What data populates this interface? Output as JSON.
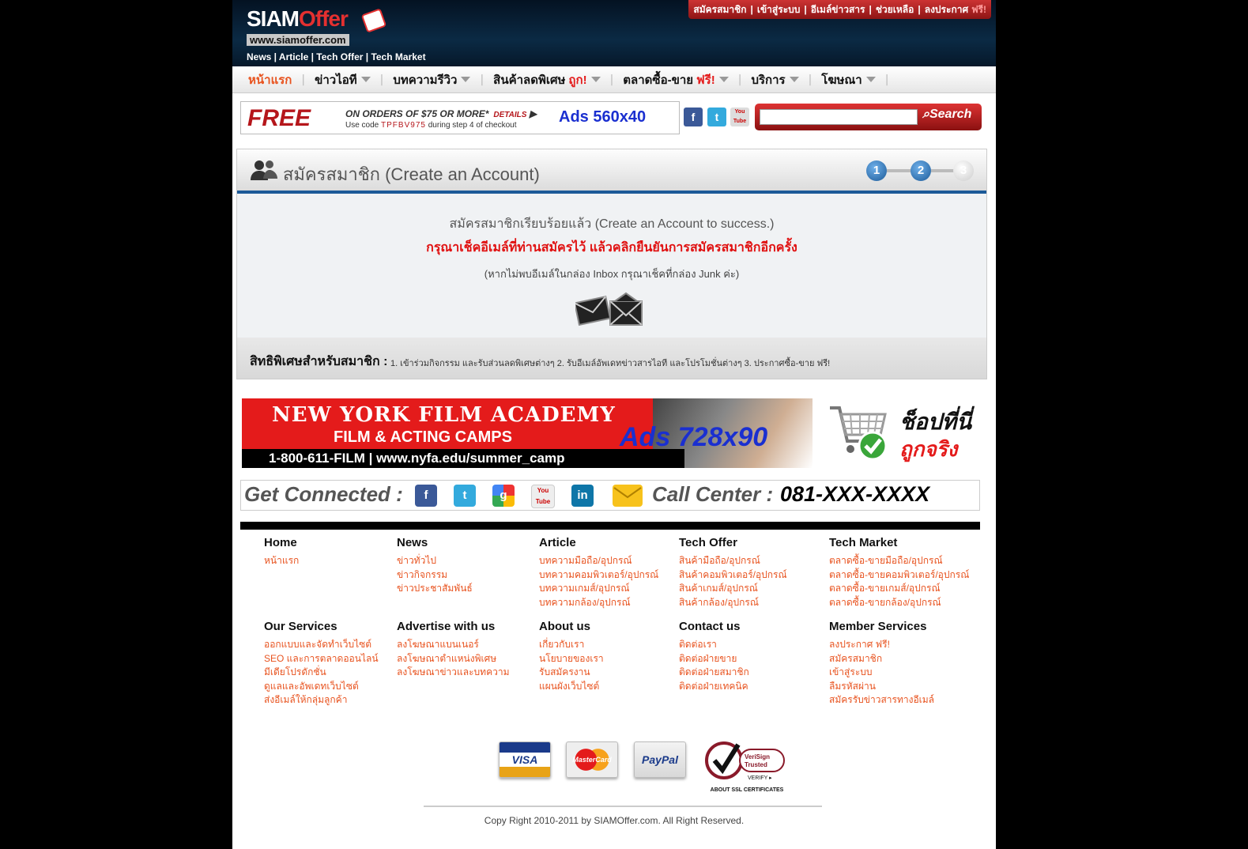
{
  "header": {
    "logo_text_a": "SIAM",
    "logo_text_b": "Offer",
    "logo_url": "www.siamoffer.com",
    "logo_sub": "News | Article | Tech Offer | Tech Market",
    "toplinks": [
      "สมัครสมาชิก",
      "เข้าสู่ระบบ",
      "อีเมล์ข่าวสาร",
      "ช่วยเหลือ",
      "ลงประกาศ"
    ],
    "toplinks_free": "ฟรี!"
  },
  "nav": {
    "items": [
      {
        "label": "หน้าแรก"
      },
      {
        "label": "ข่าวไอที"
      },
      {
        "label": "บทความรีวิว"
      },
      {
        "label": "สินค้าลดพิเศษ",
        "tag": "ถูก!"
      },
      {
        "label": "ตลาดซื้อ-ขาย",
        "tag": "ฟรี!"
      },
      {
        "label": "บริการ"
      },
      {
        "label": "โฆษณา"
      }
    ]
  },
  "ad_small": {
    "free": "FREE",
    "line1": "ON ORDERS OF $75 OR MORE*",
    "details": "DETAILS",
    "line2_a": "Use code",
    "line2_code": "TPFBV975",
    "line2_b": "during step 4 of checkout",
    "label": "Ads 560x40"
  },
  "social_top": [
    "f",
    "t",
    "You Tube"
  ],
  "search": {
    "placeholder": "",
    "button": "Search"
  },
  "account": {
    "title": "สมัครสมาชิก (Create an Account)",
    "steps": [
      "1",
      "2",
      "3"
    ],
    "msg1": "สมัครสมาชิกเรียบร้อยแล้ว (Create an Account to success.)",
    "msg2": "กรุณาเช็คอีเมล์ที่ท่านสมัครไว้ แล้วคลิกยืนยันการสมัครสมาชิกอีกครั้ง",
    "msg3": "(หากไม่พบอีเมล์ในกล่อง Inbox กรุณาเช็คที่กล่อง Junk ค่ะ)",
    "privileges_title": "สิทธิพิเศษสำหรับสมาชิก :",
    "privileges_text": "1. เข้าร่วมกิจกรรม และรับส่วนลดพิเศษต่างๆ   2. รับอีเมล์อัพเดทข่าวสารไอที และโปรโมชั่นต่างๆ   3. ประกาศซื้อ-ขาย ฟรี!"
  },
  "ad_big": {
    "line1": "NEW YORK FILM ACADEMY",
    "line2": "FILM & ACTING CAMPS",
    "line3": "1-800-611-FILM  |  www.nyfa.edu/summer_camp",
    "label": "Ads 728x90"
  },
  "cart_ad": {
    "line1": "ช็อปที่นี่",
    "line2": "ถูกจริง"
  },
  "connect": {
    "label": "Get Connected :",
    "icons": [
      "f",
      "t",
      "g",
      "You Tube",
      "in"
    ],
    "call": "Call Center :",
    "phone": "081-XXX-XXXX"
  },
  "footer": {
    "columns": [
      {
        "title": "Home",
        "links": [
          "หน้าแรก"
        ]
      },
      {
        "title": "News",
        "links": [
          "ข่าวทั่วไป",
          "ข่าวกิจกรรม",
          "ข่าวประชาสัมพันธ์"
        ]
      },
      {
        "title": "Article",
        "links": [
          "บทความมือถือ/อุปกรณ์",
          "บทความคอมพิวเตอร์/อุปกรณ์",
          "บทความเกมส์/อุปกรณ์",
          "บทความกล้อง/อุปกรณ์"
        ]
      },
      {
        "title": "Tech Offer",
        "links": [
          "สินค้ามือถือ/อุปกรณ์",
          "สินค้าคอมพิวเตอร์/อุปกรณ์",
          "สินค้าเกมส์/อุปกรณ์",
          "สินค้ากล้อง/อุปกรณ์"
        ]
      },
      {
        "title": "Tech Market",
        "links": [
          "ตลาดซื้อ-ขายมือถือ/อุปกรณ์",
          "ตลาดซื้อ-ขายคอมพิวเตอร์/อุปกรณ์",
          "ตลาดซื้อ-ขายเกมส์/อุปกรณ์",
          "ตลาดซื้อ-ขายกล้อง/อุปกรณ์"
        ]
      },
      {
        "title": "Our Services",
        "links": [
          "ออกแบบและจัดทำเว็บไซต์",
          "SEO และการตลาดออนไลน์",
          "มีเดียโปรดักชั่น",
          "ดูแลและอัพเดทเว็บไซต์",
          "ส่งอีเมล์ให้กลุ่มลูกค้า"
        ]
      },
      {
        "title": "Advertise with us",
        "links": [
          "ลงโฆษณาแบนเนอร์",
          "ลงโฆษณาตำแหน่งพิเศษ",
          "ลงโฆษณาข่าวและบทความ"
        ]
      },
      {
        "title": "About us",
        "links": [
          "เกี่ยวกับเรา",
          "นโยบายของเรา",
          "รับสมัครงาน",
          "แผนผังเว็บไซต์"
        ]
      },
      {
        "title": "Contact us",
        "links": [
          "ติดต่อเรา",
          "ติดต่อฝ่ายขาย",
          "ติดต่อฝ่ายสมาชิก",
          "ติดต่อฝ่ายเทคนิค"
        ]
      },
      {
        "title": "Member Services",
        "links": [
          "ลงประกาศ ฟรี!",
          "สมัครสมาชิก",
          "เข้าสู่ระบบ",
          "ลืมรหัสผ่าน",
          "สมัครรับข่าวสารทางอีเมล์"
        ]
      }
    ],
    "payments": [
      "VISA",
      "MasterCard",
      "PayPal"
    ],
    "verisign": {
      "a": "VeriSign",
      "b": "Trusted",
      "c": "VERIFY ▸",
      "d": "ABOUT SSL CERTIFICATES"
    },
    "copyright": "Copy Right 2010-2011 by SIAMOffer.com. All Right Reserved."
  }
}
